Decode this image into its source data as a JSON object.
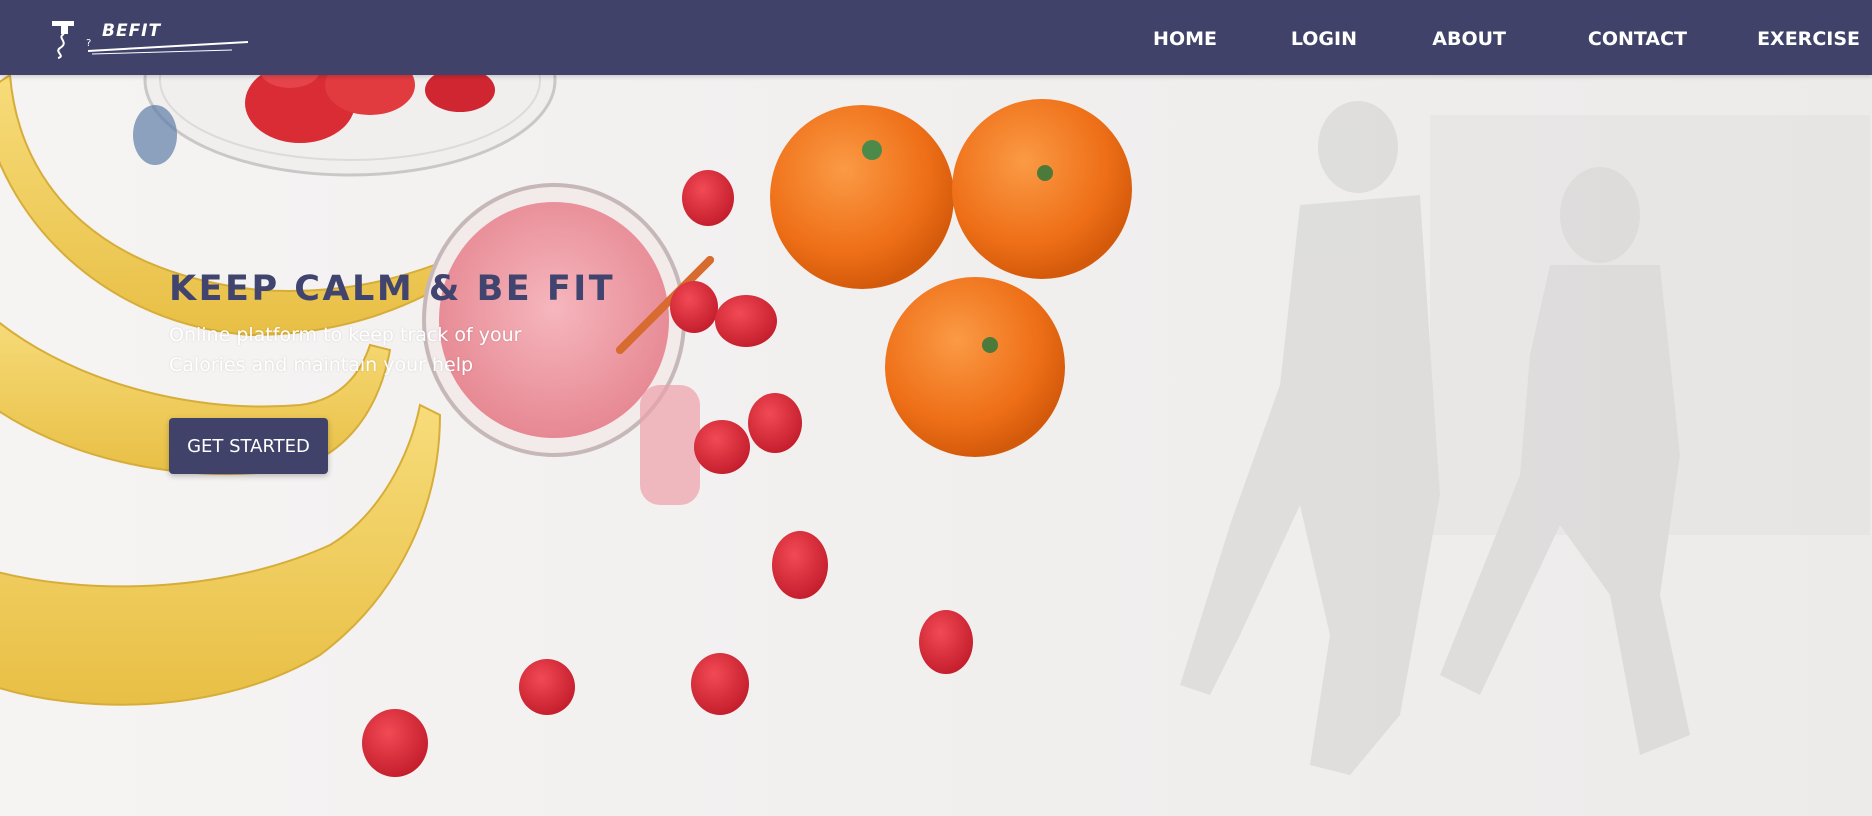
{
  "brand": {
    "name": "BEFIT"
  },
  "nav": {
    "items": [
      {
        "label": "HOME"
      },
      {
        "label": "LOGIN"
      },
      {
        "label": "ABOUT"
      },
      {
        "label": "CONTACT"
      },
      {
        "label": "EXERCISE"
      }
    ]
  },
  "hero": {
    "title": "KEEP CALM & BE FIT",
    "subtitle_line1": "Online platform to keep track of your",
    "subtitle_line2": "Calories and maintain your help",
    "cta_label": "GET STARTED"
  },
  "colors": {
    "nav_bg": "#40426a",
    "title": "#41446e",
    "button_bg": "#40426a"
  },
  "icons": [
    "befit-logo-icon"
  ]
}
